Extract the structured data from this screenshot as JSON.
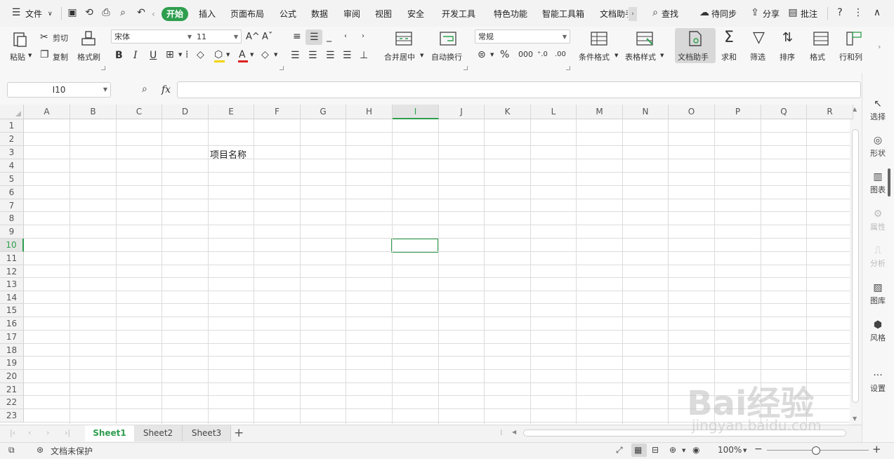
{
  "menu": {
    "file_label": "文件",
    "tabs": [
      "开始",
      "插入",
      "页面布局",
      "公式",
      "数据",
      "审阅",
      "视图",
      "安全",
      "开发工具",
      "特色功能",
      "智能工具箱",
      "文档助手"
    ],
    "search_label": "查找",
    "cloud_label": "待同步",
    "share_label": "分享",
    "batch_label": "批注"
  },
  "ribbon": {
    "paste": "粘贴",
    "cut": "剪切",
    "copy": "复制",
    "format_painter": "格式刷",
    "font_name": "宋体",
    "font_size": "11",
    "bold": "B",
    "italic": "I",
    "underline": "U",
    "merge_center": "合并居中",
    "wrap_text": "自动换行",
    "number_format": "常规",
    "conditional_format": "条件格式",
    "table_style": "表格样式",
    "doc_assistant": "文档助手",
    "sum": "求和",
    "filter": "筛选",
    "sort": "排序",
    "format": "格式",
    "row_col": "行和列"
  },
  "formula_bar": {
    "name_box": "I10",
    "fx_label": "fx",
    "content": ""
  },
  "grid": {
    "columns": [
      "A",
      "B",
      "C",
      "D",
      "E",
      "F",
      "G",
      "H",
      "I",
      "J",
      "K",
      "L",
      "M",
      "N",
      "O",
      "P",
      "Q",
      "R"
    ],
    "rows": [
      "1",
      "2",
      "3",
      "4",
      "5",
      "6",
      "7",
      "8",
      "9",
      "10",
      "11",
      "12",
      "13",
      "14",
      "15",
      "16",
      "17",
      "18",
      "19",
      "20",
      "21",
      "22",
      "23"
    ],
    "selected_column": "I",
    "selected_row": "10",
    "cell_E3": "项目名称"
  },
  "sidebar": {
    "select": "选择",
    "shape": "形状",
    "chart": "图表",
    "property": "属性",
    "analysis": "分析",
    "gallery": "图库",
    "style": "风格",
    "settings": "设置"
  },
  "sheets": {
    "tabs": [
      "Sheet1",
      "Sheet2",
      "Sheet3"
    ],
    "active": "Sheet1",
    "add": "+"
  },
  "status": {
    "protect": "文档未保护",
    "zoom": "100%",
    "minus": "−",
    "plus": "+"
  },
  "watermark": {
    "brand": "Bai经验",
    "url": "jingyan.baidu.com"
  },
  "colors": {
    "accent": "#2e9e4e"
  }
}
